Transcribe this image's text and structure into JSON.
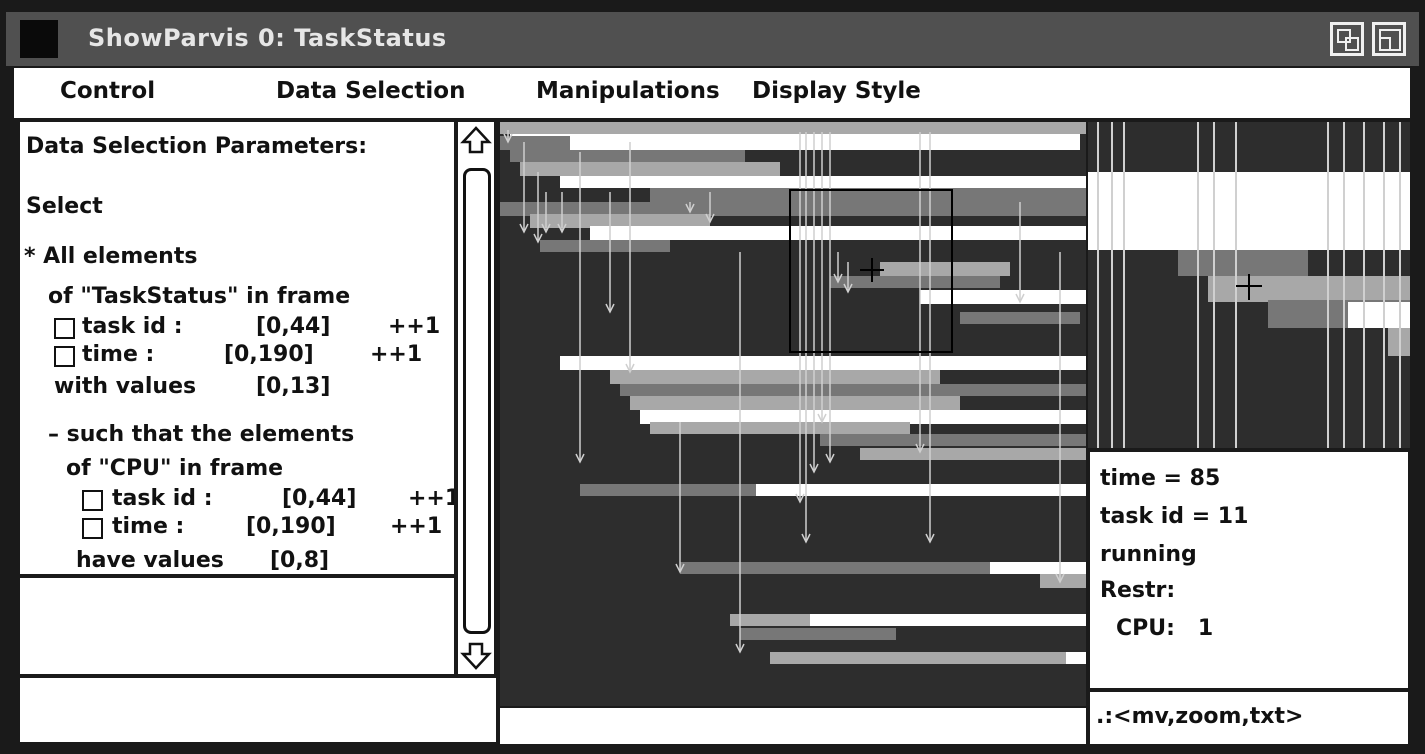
{
  "window": {
    "title": "ShowParvis 0: TaskStatus"
  },
  "menu": {
    "control": "Control",
    "data_selection": "Data Selection",
    "manipulations": "Manipulations",
    "display_style": "Display Style"
  },
  "params": {
    "heading": "Data Selection Parameters:",
    "select": "Select",
    "all_elements": "* All elements",
    "of_frame": "of \"TaskStatus\" in frame",
    "task_id_label": "task id :",
    "task_id_range": "[0,44]",
    "task_id_step": "++1",
    "time_label": "time :",
    "time_range": "[0,190]",
    "time_step": "++1",
    "with_values_label": "with values",
    "with_values_range": "[0,13]",
    "such_that": "– such that the elements",
    "of_cpu_frame": "of \"CPU\" in frame",
    "cpu_task_id_label": "task id :",
    "cpu_task_id_range": "[0,44]",
    "cpu_task_id_step": "++1",
    "cpu_time_label": "time :",
    "cpu_time_range": "[0,190]",
    "cpu_time_step": "++1",
    "have_values_label": "have values",
    "have_values_range": "[0,8]"
  },
  "scrollbar": {
    "up_icon": "arrow-up-icon",
    "down_icon": "arrow-down-icon"
  },
  "info": {
    "time": "time = 85",
    "task_id": "task id = 11",
    "state": "running",
    "restr": "Restr:",
    "cpu": "CPU:   1"
  },
  "command": {
    "text": ".:<mv,zoom,txt>"
  },
  "colors": {
    "background": "#2d2d2d",
    "light": "#ffffff",
    "mid": "#a8a8a8",
    "dark_mid": "#777777",
    "title_bar": "#505050"
  },
  "icons": {
    "window_box": "window-menu-icon",
    "resize": "resize-icon",
    "maximize": "maximize-icon",
    "cursor": "crosshair-icon"
  }
}
